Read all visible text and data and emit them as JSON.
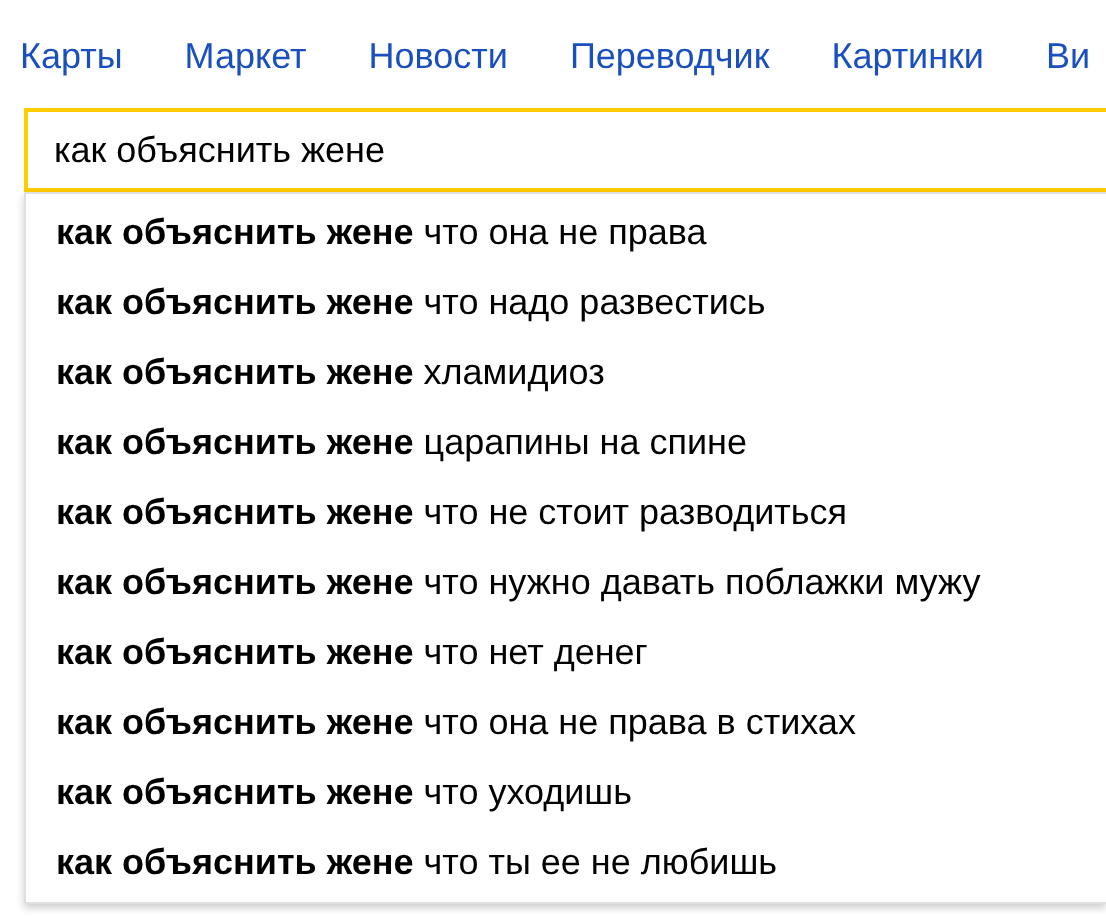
{
  "nav_links": [
    "Карты",
    "Маркет",
    "Новости",
    "Переводчик",
    "Картинки",
    "Ви"
  ],
  "search": {
    "value": "как объяснить жене"
  },
  "suggestions": [
    "**как объяснить жене** что она не права",
    "**как объяснить жене** что надо развестись",
    "**как объяснить жене** хламидиоз",
    "**как объяснить жене** царапины на спине",
    "**как объяснить жене** что не стоит разводиться",
    "**как объяснить жене** что нужно давать поблажки мужу",
    "**как объяснить жене** что нет денег",
    "**как объяснить жене** что она не права в стихах",
    "**как объяснить жене** что уходишь",
    "**как объяснить жене** что ты ее не любишь"
  ]
}
